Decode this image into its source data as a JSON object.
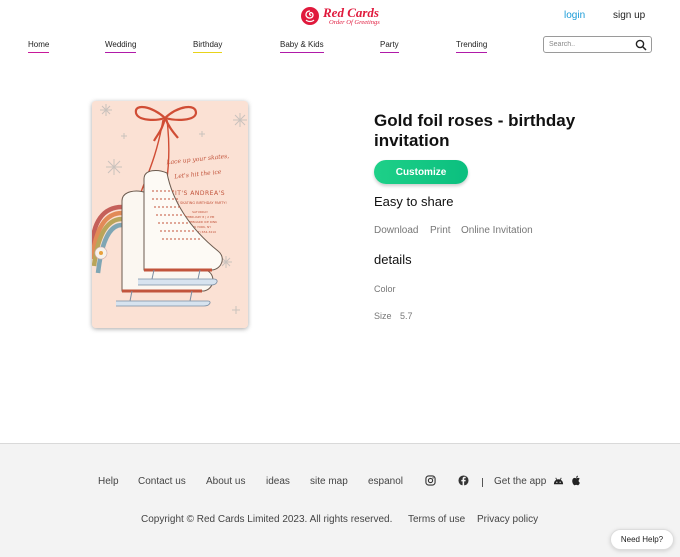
{
  "header": {
    "logo_title": "Red Cards",
    "logo_subtitle": "Order Of Greetings",
    "login_label": "login",
    "signup_label": "sign up"
  },
  "nav": {
    "items": [
      {
        "label": "Home",
        "color": "#c8189a"
      },
      {
        "label": "Wedding",
        "color": "#b01aa8"
      },
      {
        "label": "Birthday",
        "color": "#e8d31a"
      },
      {
        "label": "Baby & Kids",
        "color": "#b01aa8"
      },
      {
        "label": "Party",
        "color": "#b01aa8"
      },
      {
        "label": "Trending",
        "color": "#b01aa8"
      }
    ]
  },
  "search": {
    "placeholder": "Search..",
    "icon": "search-icon"
  },
  "card": {
    "line1": "Lace up your skates,",
    "line2": "Let's hit the ice",
    "name_line": "IT'S ANDREA'S",
    "event_line": "ICE SKATING BIRTHDAY PARTY!",
    "detail1": "SATURDAY",
    "detail2": "FEBRUARY 8 | 2 PM",
    "detail3": "SKATEBOARD ICE RINK",
    "detail4": "NEW YORK, NY",
    "detail5": "RSVP (987) 654-3210"
  },
  "product": {
    "title": "Gold foil roses - birthday invitation",
    "customize_label": "Customize",
    "share_heading": "Easy to share",
    "share_options": [
      "Download",
      "Print",
      "Online Invitation"
    ],
    "details_heading": "details",
    "color_label": "Color",
    "size_label": "Size",
    "size_value": "5.7"
  },
  "footer": {
    "links": [
      "Help",
      "Contact us",
      "About us",
      "ideas",
      "site map",
      "espanol"
    ],
    "instagram_icon": "instagram-icon",
    "facebook_icon": "facebook-icon",
    "get_app_label": "Get the app",
    "android_icon": "android-icon",
    "apple_icon": "apple-icon",
    "copyright": "Copyright © Red Cards Limited 2023. All rights reserved.",
    "terms_label": "Terms of use",
    "privacy_label": "Privacy policy"
  },
  "need_help_label": "Need Help?",
  "colors": {
    "brand": "#e0193c",
    "login": "#1a9bd7",
    "customize": "#12c884",
    "card_background": "#fbe1d4"
  }
}
